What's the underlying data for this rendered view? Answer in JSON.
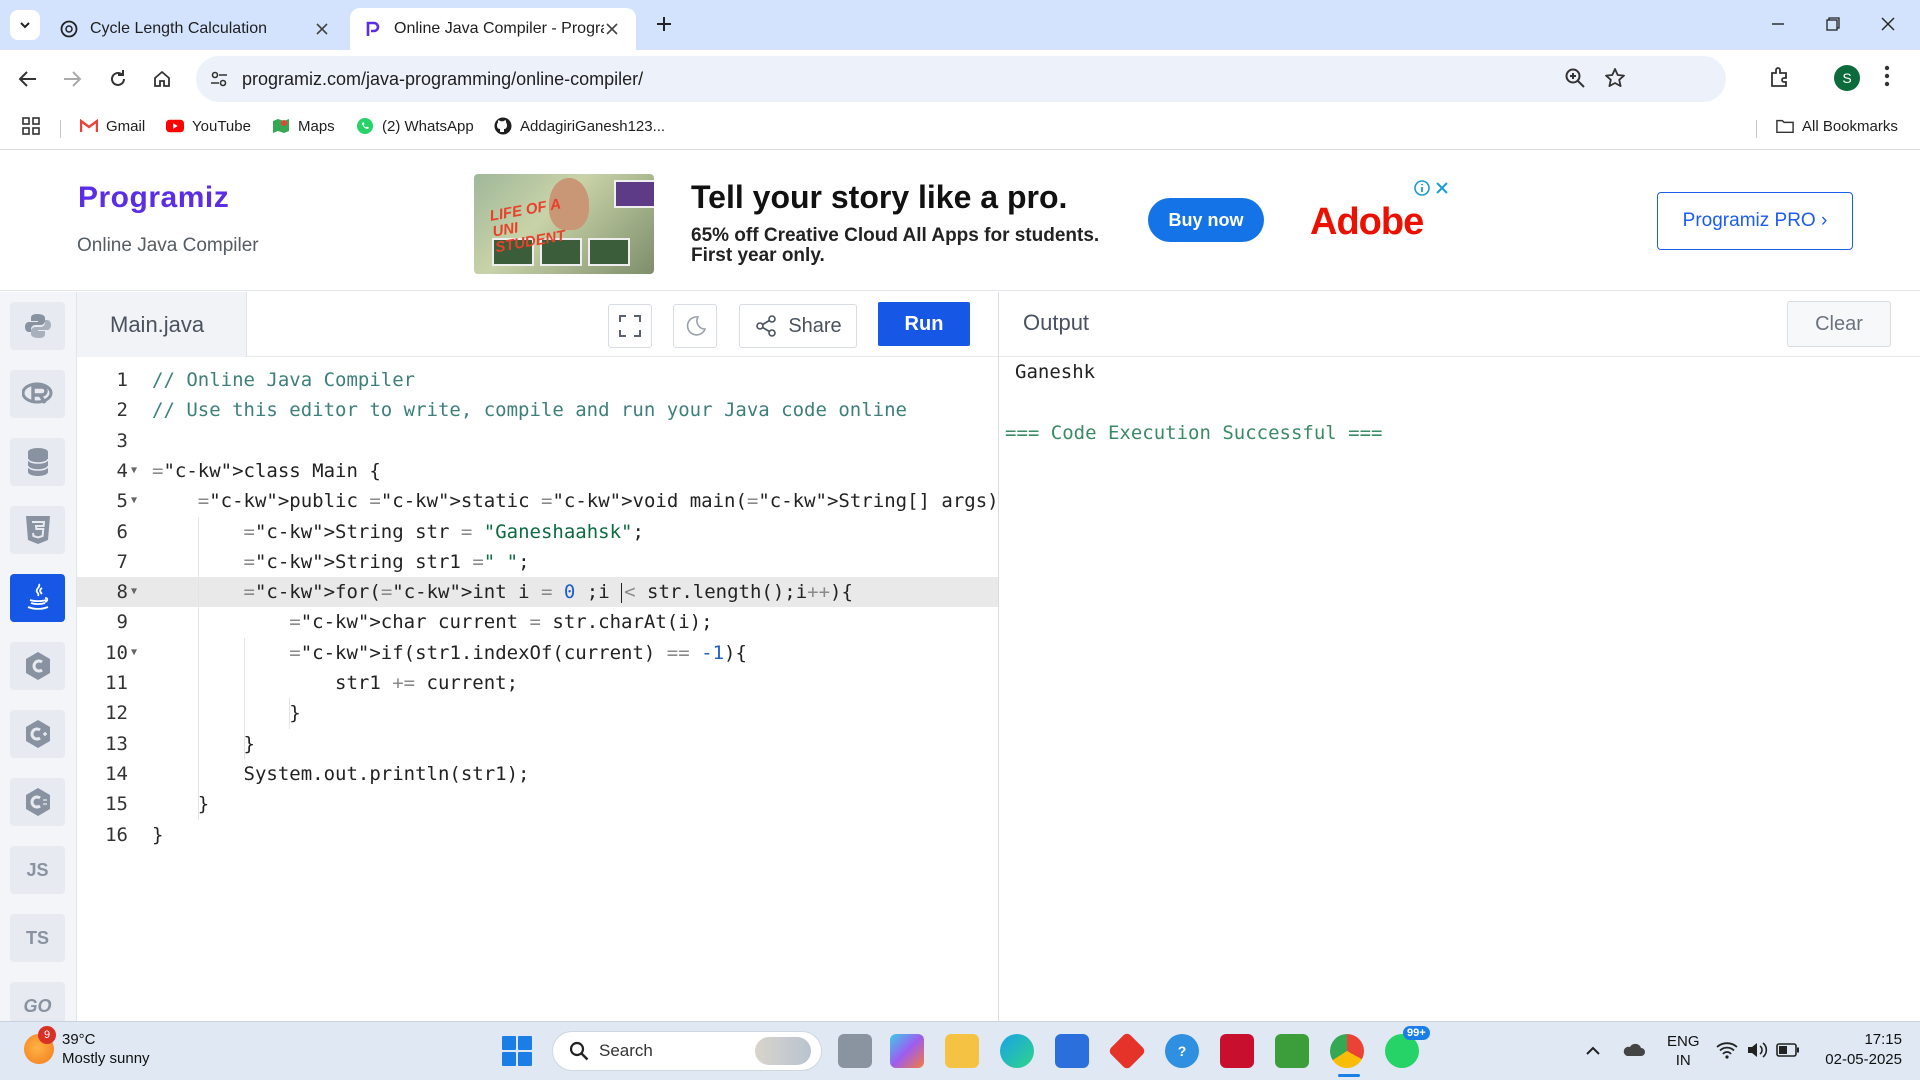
{
  "browser": {
    "tabs": [
      {
        "title": "Cycle Length Calculation",
        "icon": "openai-icon",
        "active": false
      },
      {
        "title": "Online Java Compiler - Program",
        "icon": "programiz-icon",
        "active": true
      }
    ],
    "url": "programiz.com/java-programming/online-compiler/",
    "profile_initial": "S",
    "bookmarks": [
      {
        "label": "Gmail",
        "icon": "gmail-icon"
      },
      {
        "label": "YouTube",
        "icon": "youtube-icon"
      },
      {
        "label": "Maps",
        "icon": "maps-icon"
      },
      {
        "label": "(2) WhatsApp",
        "icon": "whatsapp-icon"
      },
      {
        "label": "AddagiriGanesh123...",
        "icon": "github-icon"
      }
    ],
    "all_bookmarks": "All Bookmarks"
  },
  "header": {
    "logo": "Programiz",
    "subtitle": "Online Java Compiler",
    "pro_button": "Programiz PRO ›"
  },
  "ad": {
    "image_text": "LIFE OF A UNI STUDENT",
    "title": "Tell your story like a pro.",
    "line1": "65% off Creative Cloud All Apps for students.",
    "line2": "First year only.",
    "cta": "Buy now",
    "brand": "Adobe"
  },
  "languages": [
    {
      "name": "python-icon",
      "label": ""
    },
    {
      "name": "r-icon",
      "label": ""
    },
    {
      "name": "sql-icon",
      "label": ""
    },
    {
      "name": "html-icon",
      "label": ""
    },
    {
      "name": "java-icon",
      "label": "",
      "active": true
    },
    {
      "name": "c-icon",
      "label": ""
    },
    {
      "name": "cpp-icon",
      "label": ""
    },
    {
      "name": "csharp-icon",
      "label": ""
    },
    {
      "name": "js-icon",
      "label": "JS"
    },
    {
      "name": "ts-icon",
      "label": "TS"
    },
    {
      "name": "go-icon",
      "label": "GO"
    }
  ],
  "editor": {
    "file_name": "Main.java",
    "share_label": "Share",
    "run_label": "Run",
    "active_line": 8,
    "lines": [
      "// Online Java Compiler",
      "// Use this editor to write, compile and run your Java code online",
      "",
      "class Main {",
      "    public static void main(String[] args) {",
      "        String str = \"Ganeshaahsk\";",
      "        String str1 =\" \";",
      "        for(int i = 0 ;i < str.length();i++){",
      "            char current = str.charAt(i);",
      "            if(str1.indexOf(current) == -1){",
      "                str1 += current;",
      "            }",
      "        }",
      "        System.out.println(str1);",
      "    }",
      "}"
    ]
  },
  "output": {
    "title": "Output",
    "clear_label": "Clear",
    "lines": [
      "Ganeshk",
      "=== Code Execution Successful ==="
    ]
  },
  "taskbar": {
    "weather_temp": "39°C",
    "weather_desc": "Mostly sunny",
    "weather_badge": "9",
    "search_label": "Search",
    "whatsapp_badge": "99+",
    "lang_top": "ENG",
    "lang_bottom": "IN",
    "time": "17:15",
    "date": "02-05-2025"
  }
}
